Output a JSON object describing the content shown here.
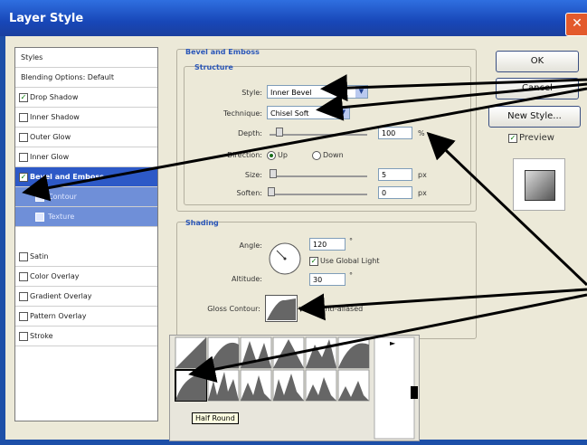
{
  "window": {
    "title": "Layer Style"
  },
  "styles_list": {
    "items": [
      {
        "label": "Styles",
        "type": "header"
      },
      {
        "label": "Blending Options: Default",
        "type": "header"
      },
      {
        "label": "Drop Shadow",
        "checked": true
      },
      {
        "label": "Inner Shadow",
        "checked": false
      },
      {
        "label": "Outer Glow",
        "checked": false
      },
      {
        "label": "Inner Glow",
        "checked": false
      },
      {
        "label": "Bevel and Emboss",
        "checked": true,
        "selected": true
      },
      {
        "label": "Contour",
        "checked": false,
        "sub": true
      },
      {
        "label": "Texture",
        "checked": false,
        "sub": true
      },
      {
        "label": "Satin",
        "checked": false
      },
      {
        "label": "Color Overlay",
        "checked": false
      },
      {
        "label": "Gradient Overlay",
        "checked": false
      },
      {
        "label": "Pattern Overlay",
        "checked": false
      },
      {
        "label": "Stroke",
        "checked": false
      }
    ]
  },
  "bevel": {
    "group_title": "Bevel and Emboss",
    "structure_title": "Structure",
    "style_label": "Style:",
    "style_value": "Inner Bevel",
    "technique_label": "Technique:",
    "technique_value": "Chisel Soft",
    "depth_label": "Depth:",
    "depth_value": "100",
    "depth_unit": "%",
    "direction_label": "Direction:",
    "dir_up": "Up",
    "dir_down": "Down",
    "size_label": "Size:",
    "size_value": "5",
    "size_unit": "px",
    "soften_label": "Soften:",
    "soften_value": "0",
    "soften_unit": "px"
  },
  "shading": {
    "title": "Shading",
    "angle_label": "Angle:",
    "angle_value": "120",
    "angle_unit": "°",
    "global_light_label": "Use Global Light",
    "altitude_label": "Altitude:",
    "altitude_value": "30",
    "altitude_unit": "°",
    "gloss_label": "Gloss Contour:",
    "anti_aliased_label": "Anti-aliased"
  },
  "buttons": {
    "ok": "OK",
    "cancel": "Cancel",
    "new_style": "New Style...",
    "preview": "Preview"
  },
  "contour_picker": {
    "tooltip": "Half Round",
    "selected_index": 6
  },
  "colors": {
    "title_bar": "#2f6fe0",
    "selection": "#2d59c7",
    "arrow": "#000000"
  }
}
